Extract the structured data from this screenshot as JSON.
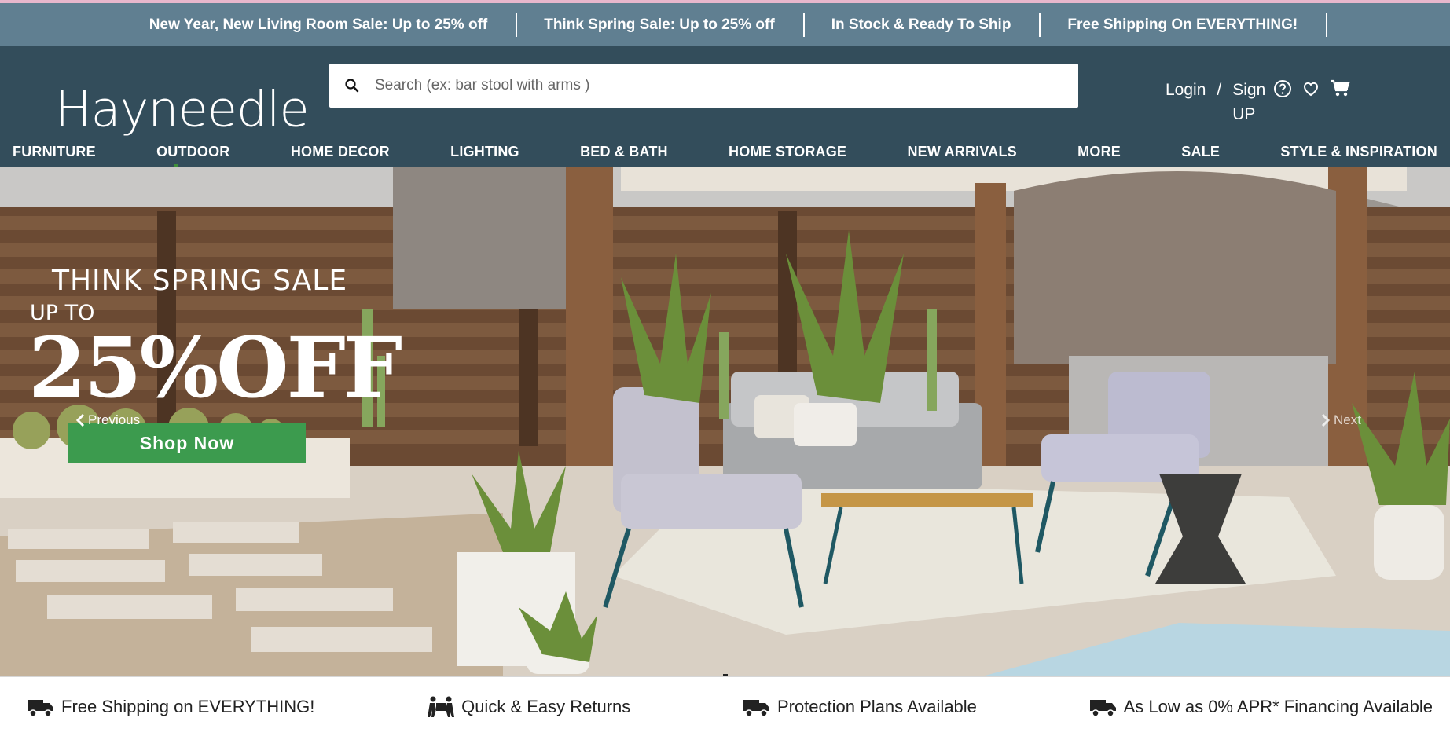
{
  "promo_bar": {
    "items": [
      "New Year, New Living Room Sale: Up to 25% off",
      "Think Spring Sale: Up to 25% off",
      "In Stock & Ready To Ship",
      "Free Shipping On EVERYTHING!"
    ]
  },
  "header": {
    "logo": "Hayneedle",
    "search": {
      "placeholder": "Search (ex: bar stool with arms )",
      "value": ""
    },
    "account": {
      "login": "Login",
      "separator": "/",
      "signup": "Sign UP"
    },
    "icons": [
      "help-icon",
      "heart-icon",
      "cart-icon"
    ]
  },
  "nav": {
    "items": [
      "FURNITURE",
      "OUTDOOR",
      "HOME DECOR",
      "LIGHTING",
      "BED & BATH",
      "HOME STORAGE",
      "NEW ARRIVALS",
      "MORE",
      "SALE",
      "STYLE & INSPIRATION"
    ]
  },
  "hero": {
    "title": "THINK SPRING SALE",
    "upto": "UP TO",
    "discount": "25%OFF",
    "cta": "Shop Now",
    "prev": "Previous",
    "next": "Next"
  },
  "features": {
    "items": [
      "Free Shipping on EVERYTHING!",
      "Quick & Easy Returns",
      "Protection Plans Available",
      "As Low as 0% APR* Financing Available"
    ]
  },
  "colors": {
    "promo_bar": "#607f91",
    "header": "#334d5b",
    "cta": "#3c9b4e"
  }
}
